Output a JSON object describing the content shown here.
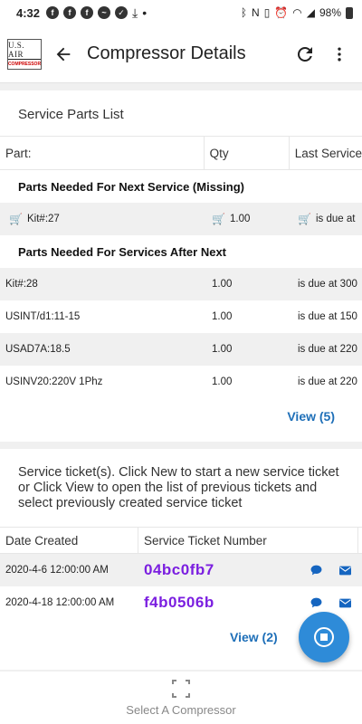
{
  "status_bar": {
    "time": "4:32",
    "battery": "98%"
  },
  "app_bar": {
    "logo_top": "U.S. AIR",
    "logo_bottom": "COMPRESSOR",
    "title": "Compressor Details"
  },
  "parts": {
    "title": "Service Parts List",
    "headers": {
      "part": "Part:",
      "qty": "Qty",
      "last": "Last Service"
    },
    "missing_title": "Parts Needed For Next Service (Missing)",
    "missing": [
      {
        "part": "Kit#:27",
        "qty": "1.00",
        "last": "is due at"
      }
    ],
    "after_title": "Parts Needed For Services After Next",
    "after": [
      {
        "part": "Kit#:28",
        "qty": "1.00",
        "last": "is due at 300"
      },
      {
        "part": "USINT/d1:11-15",
        "qty": "1.00",
        "last": "is due at 150"
      },
      {
        "part": "USAD7A:18.5",
        "qty": "1.00",
        "last": "is due at 220"
      },
      {
        "part": "USINV20:220V 1Phz",
        "qty": "1.00",
        "last": "is due at 220"
      }
    ],
    "view_label": "View (5)"
  },
  "tickets": {
    "description": "Service ticket(s). Click New to start a new service ticket or Click View to open the list of previous tickets and select previously created service ticket",
    "headers": {
      "date": "Date Created",
      "number": "Service Ticket Number"
    },
    "rows": [
      {
        "date": "2020-4-6 12:00:00 AM",
        "number": "04bc0fb7"
      },
      {
        "date": "2020-4-18 12:00:00 AM",
        "number": "f4b0506b"
      }
    ],
    "view_label": "View (2)"
  },
  "bottom_nav": {
    "label": "Select A Compressor"
  },
  "colors": {
    "accent": "#1e6fb8",
    "ticket_number": "#7b1fe0",
    "missing_icon": "#d32f2f",
    "fab": "#2e8bd8"
  }
}
